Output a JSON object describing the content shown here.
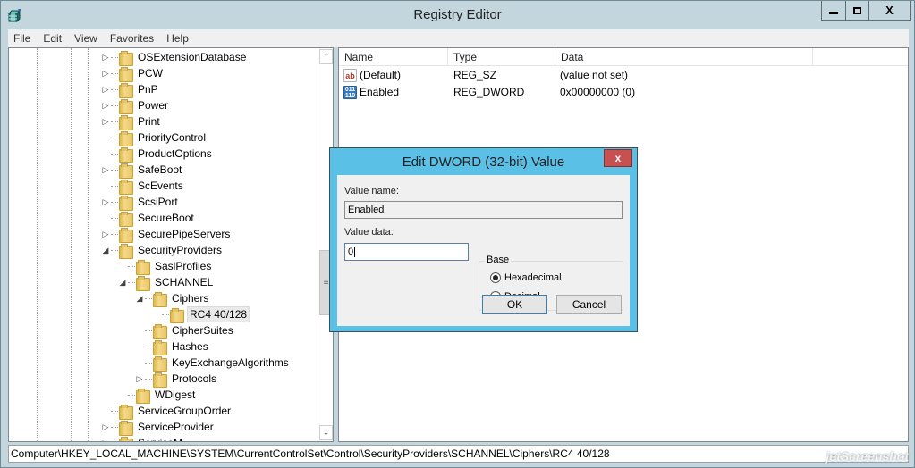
{
  "window": {
    "title": "Registry Editor",
    "controls": {
      "minimize": "minimize",
      "maximize": "maximize",
      "close": "X"
    }
  },
  "menu": [
    "File",
    "Edit",
    "View",
    "Favorites",
    "Help"
  ],
  "tree": {
    "items": [
      {
        "label": "OSExtensionDatabase",
        "level": 0,
        "expander": "collapsed"
      },
      {
        "label": "PCW",
        "level": 0,
        "expander": "collapsed"
      },
      {
        "label": "PnP",
        "level": 0,
        "expander": "collapsed"
      },
      {
        "label": "Power",
        "level": 0,
        "expander": "collapsed"
      },
      {
        "label": "Print",
        "level": 0,
        "expander": "collapsed"
      },
      {
        "label": "PriorityControl",
        "level": 0,
        "expander": "none"
      },
      {
        "label": "ProductOptions",
        "level": 0,
        "expander": "none"
      },
      {
        "label": "SafeBoot",
        "level": 0,
        "expander": "collapsed"
      },
      {
        "label": "ScEvents",
        "level": 0,
        "expander": "none"
      },
      {
        "label": "ScsiPort",
        "level": 0,
        "expander": "collapsed"
      },
      {
        "label": "SecureBoot",
        "level": 0,
        "expander": "none"
      },
      {
        "label": "SecurePipeServers",
        "level": 0,
        "expander": "collapsed"
      },
      {
        "label": "SecurityProviders",
        "level": 0,
        "expander": "expanded"
      },
      {
        "label": "SaslProfiles",
        "level": 1,
        "expander": "none"
      },
      {
        "label": "SCHANNEL",
        "level": 1,
        "expander": "expanded"
      },
      {
        "label": "Ciphers",
        "level": 2,
        "expander": "expanded"
      },
      {
        "label": "RC4 40/128",
        "level": 3,
        "expander": "none",
        "selected": true
      },
      {
        "label": "CipherSuites",
        "level": 2,
        "expander": "none"
      },
      {
        "label": "Hashes",
        "level": 2,
        "expander": "none"
      },
      {
        "label": "KeyExchangeAlgorithms",
        "level": 2,
        "expander": "none"
      },
      {
        "label": "Protocols",
        "level": 2,
        "expander": "collapsed"
      },
      {
        "label": "WDigest",
        "level": 1,
        "expander": "none"
      },
      {
        "label": "ServiceGroupOrder",
        "level": 0,
        "expander": "none"
      },
      {
        "label": "ServiceProvider",
        "level": 0,
        "expander": "collapsed"
      },
      {
        "label": "ServiceM...",
        "level": 0,
        "expander": "collapsed"
      }
    ]
  },
  "list": {
    "columns": [
      "Name",
      "Type",
      "Data"
    ],
    "rows": [
      {
        "icon": "string-value-icon",
        "icon_text": "ab",
        "name": "(Default)",
        "type": "REG_SZ",
        "data": "(value not set)"
      },
      {
        "icon": "binary-value-icon",
        "icon_text": "011 110",
        "name": "Enabled",
        "type": "REG_DWORD",
        "data": "0x00000000 (0)"
      }
    ]
  },
  "statusbar": {
    "path": "Computer\\HKEY_LOCAL_MACHINE\\SYSTEM\\CurrentControlSet\\Control\\SecurityProviders\\SCHANNEL\\Ciphers\\RC4 40/128"
  },
  "watermark": "jetScreenshot",
  "dialog": {
    "title": "Edit DWORD (32-bit) Value",
    "close": "x",
    "value_name_label": "Value name:",
    "value_name": "Enabled",
    "value_data_label": "Value data:",
    "value_data": "0",
    "base_label": "Base",
    "base_options": [
      {
        "label": "Hexadecimal",
        "checked": true
      },
      {
        "label": "Decimal",
        "checked": false
      }
    ],
    "ok_label": "OK",
    "cancel_label": "Cancel"
  }
}
